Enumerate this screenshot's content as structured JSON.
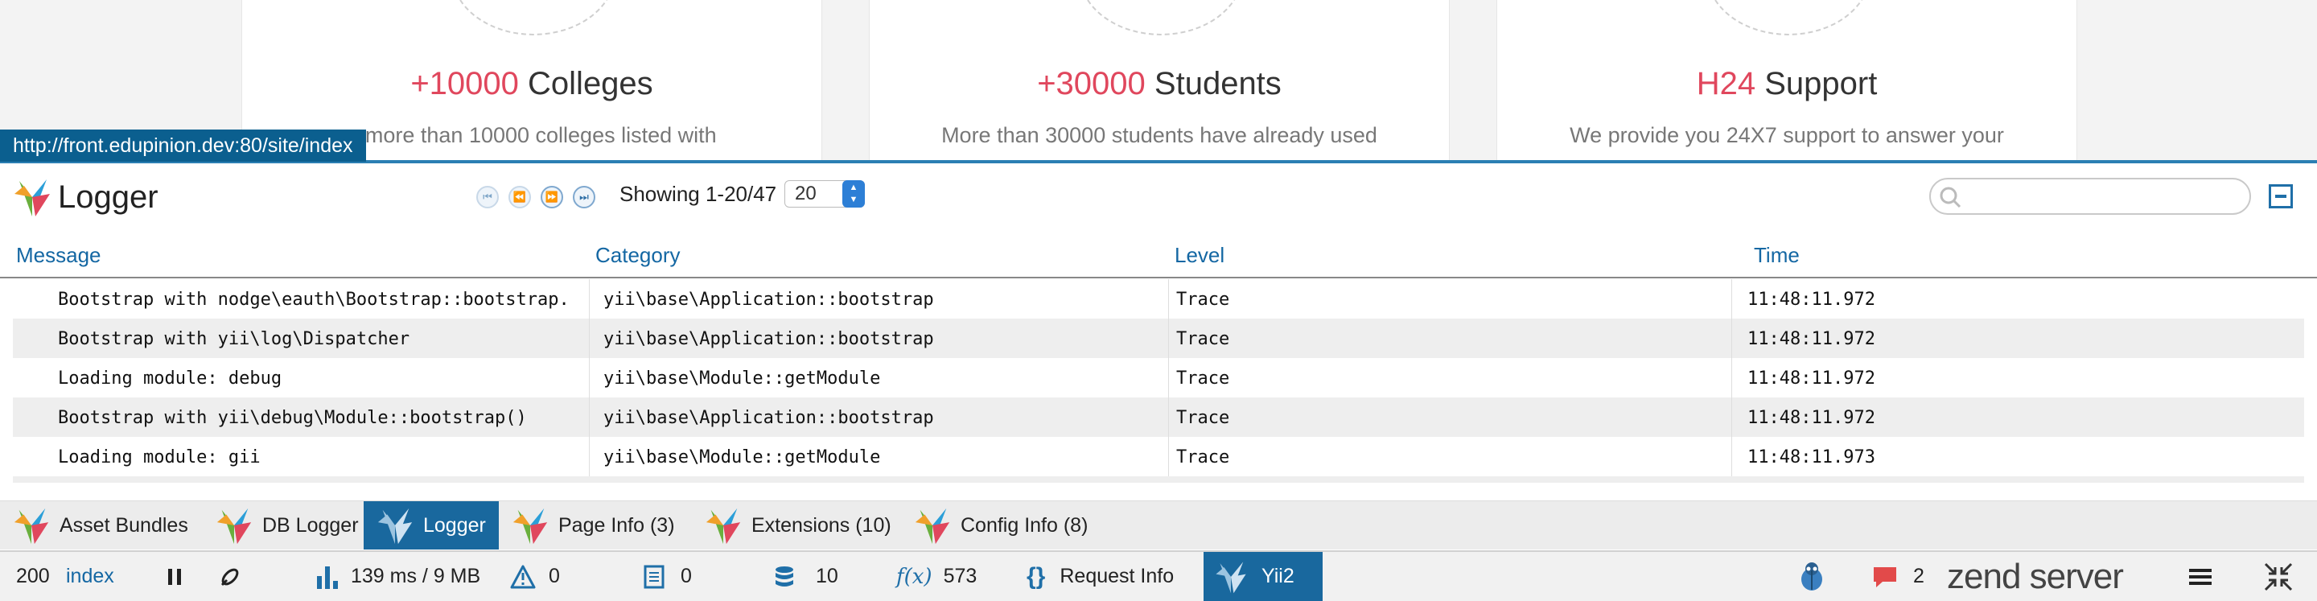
{
  "background_page": {
    "cards": [
      {
        "accent": "+10000",
        "title": "Colleges",
        "text": "e more than 10000 colleges listed with"
      },
      {
        "accent": "+30000",
        "title": "Students",
        "text": "More than 30000 students have already used"
      },
      {
        "accent": "H24",
        "title": "Support",
        "text": "We provide you 24X7 support to answer your"
      }
    ],
    "status_url": "http://front.edupinion.dev:80/site/index"
  },
  "panel": {
    "title": "Logger",
    "showing": "Showing 1-20/47",
    "per_page": "20",
    "search_placeholder": "",
    "columns": [
      "Message",
      "Category",
      "Level",
      "Time"
    ],
    "rows": [
      {
        "message": "Bootstrap with nodge\\eauth\\Bootstrap::bootstrap.",
        "category": "yii\\base\\Application::bootstrap",
        "level": "Trace",
        "time": "11:48:11.972"
      },
      {
        "message": "Bootstrap with yii\\log\\Dispatcher",
        "category": "yii\\base\\Application::bootstrap",
        "level": "Trace",
        "time": "11:48:11.972"
      },
      {
        "message": "Loading module: debug",
        "category": "yii\\base\\Module::getModule",
        "level": "Trace",
        "time": "11:48:11.972"
      },
      {
        "message": "Bootstrap with yii\\debug\\Module::bootstrap()",
        "category": "yii\\base\\Application::bootstrap",
        "level": "Trace",
        "time": "11:48:11.972"
      },
      {
        "message": "Loading module: gii",
        "category": "yii\\base\\Module::getModule",
        "level": "Trace",
        "time": "11:48:11.973"
      }
    ]
  },
  "tabs": [
    {
      "label": "Asset Bundles",
      "active": false
    },
    {
      "label": "DB Logger",
      "active": false
    },
    {
      "label": "Logger",
      "active": true
    },
    {
      "label": "Page Info (3)",
      "active": false
    },
    {
      "label": "Extensions (10)",
      "active": false
    },
    {
      "label": "Config Info (8)",
      "active": false
    }
  ],
  "toolbar": {
    "status_code": "200",
    "route": "index",
    "timing": "139 ms / 9 MB",
    "warnings": "0",
    "log_count": "0",
    "db_queries": "10",
    "functions": "573",
    "request_info": "Request Info",
    "brand": "Yii2",
    "messages": "2",
    "zend_brand": "zend server",
    "icons": [
      "pause-icon",
      "pin-icon",
      "bar-chart-icon",
      "warning-icon",
      "document-icon",
      "database-icon",
      "function-icon",
      "braces-icon",
      "yii-logo-icon",
      "bug-icon",
      "chat-bubble-icon",
      "menu-icon",
      "collapse-arrows-icon"
    ]
  },
  "colors": {
    "accent_red": "#e0475d",
    "debug_blue": "#19689e",
    "link_blue": "#1467a3"
  }
}
